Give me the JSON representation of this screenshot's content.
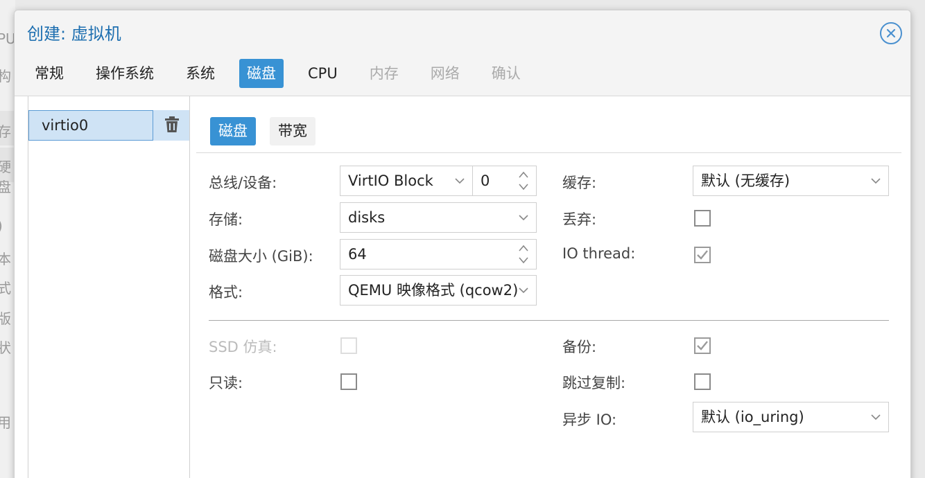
{
  "background": {
    "chars": [
      "PU",
      "构",
      "存",
      "硬盘",
      ")",
      "本",
      "式",
      "版",
      "状",
      "用"
    ]
  },
  "dialog": {
    "title": "创建: 虚拟机",
    "close_icon": "close-circle-icon"
  },
  "tabs": [
    {
      "label": "常规",
      "state": "normal"
    },
    {
      "label": "操作系统",
      "state": "normal"
    },
    {
      "label": "系统",
      "state": "normal"
    },
    {
      "label": "磁盘",
      "state": "active"
    },
    {
      "label": "CPU",
      "state": "normal"
    },
    {
      "label": "内存",
      "state": "disabled"
    },
    {
      "label": "网络",
      "state": "disabled"
    },
    {
      "label": "确认",
      "state": "disabled"
    }
  ],
  "disk_list": {
    "selected": "virtio0",
    "delete_icon": "trash-icon"
  },
  "sub_tabs": [
    {
      "label": "磁盘",
      "state": "active"
    },
    {
      "label": "带宽",
      "state": "normal"
    }
  ],
  "form": {
    "bus_device": {
      "label": "总线/设备:",
      "bus": "VirtIO Block",
      "device": "0"
    },
    "storage": {
      "label": "存储:",
      "value": "disks"
    },
    "disk_size": {
      "label": "磁盘大小 (GiB):",
      "value": "64"
    },
    "format": {
      "label": "格式:",
      "value": "QEMU 映像格式 (qcow2)"
    },
    "cache": {
      "label": "缓存:",
      "value": "默认 (无缓存)"
    },
    "discard": {
      "label": "丢弃:",
      "checked": false
    },
    "io_thread": {
      "label": "IO thread:",
      "checked": true
    },
    "ssd_emulation": {
      "label": "SSD 仿真:",
      "checked": false,
      "disabled": true
    },
    "read_only": {
      "label": "只读:",
      "checked": false
    },
    "backup": {
      "label": "备份:",
      "checked": true
    },
    "skip_replication": {
      "label": "跳过复制:",
      "checked": false
    },
    "async_io": {
      "label": "异步 IO:",
      "value": "默认 (io_uring)"
    }
  },
  "colors": {
    "accent": "#3892d4",
    "title": "#1e6fb0",
    "selection": "#cfe3f5"
  }
}
